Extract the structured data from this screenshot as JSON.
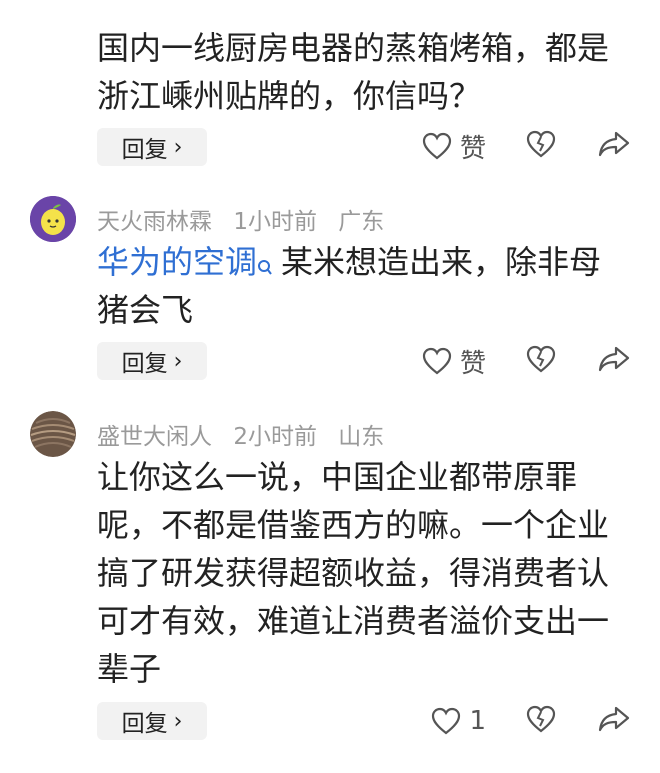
{
  "comments": [
    {
      "id": "c0",
      "body": "国内一线厨房电器的蒸箱烤箱，都是浙江嵊州贴牌的，你信吗？",
      "body_line0": "国内一线厨房电器的蒸箱烤箱，都是",
      "body_line1": "浙江嵊州贴牌的，你信吗？",
      "reply": "回复",
      "like_label": "赞"
    },
    {
      "id": "c1",
      "username": "天火雨林霖",
      "time": "1小时前",
      "location": "广东",
      "link_text": "华为的空调",
      "body_rest_line0": "某米想造出来，除非母",
      "body_line1": "猪会飞",
      "reply": "回复",
      "like_label": "赞"
    },
    {
      "id": "c2",
      "username": "盛世大闲人",
      "time": "2小时前",
      "location": "山东",
      "body_lines": [
        "让你这么一说，中国企业都带原罪",
        "呢，不都是借鉴西方的嘛。一个企业",
        "搞了研发获得超额收益，得消费者认",
        "可才有效，难道让消费者溢价支出一",
        "辈子"
      ],
      "reply": "回复",
      "like_count": "1"
    }
  ],
  "icons": {
    "like": "heart-outline-icon",
    "dislike": "broken-heart-icon",
    "share": "share-arrow-icon",
    "search": "search-icon",
    "chevron": "chevron-right-icon"
  }
}
